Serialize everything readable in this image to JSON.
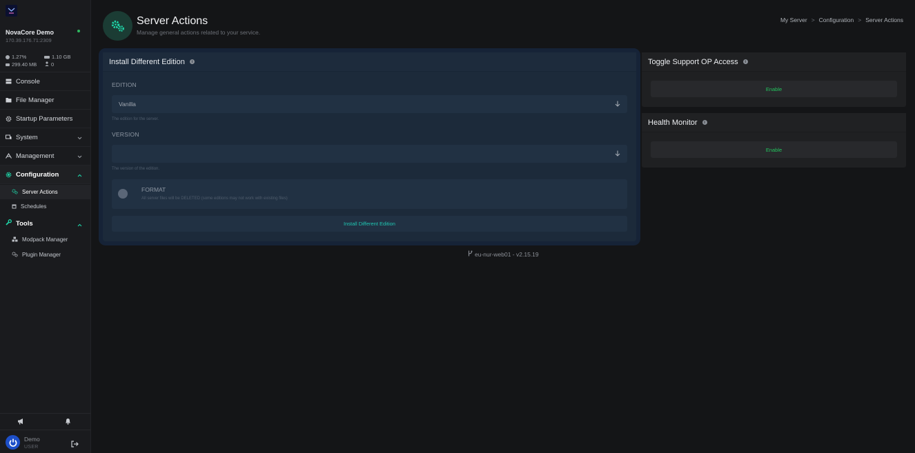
{
  "sidebar": {
    "server_name": "NovaCore Demo",
    "server_ip": "170.39.176.71:2309",
    "stats": {
      "cpu": "1.27%",
      "memory": "1.10 GB",
      "disk": "299.40 MB",
      "players": "0"
    },
    "nav": {
      "console": "Console",
      "file_manager": "File Manager",
      "startup_parameters": "Startup Parameters",
      "system": "System",
      "management": "Management",
      "configuration": "Configuration",
      "server_actions": "Server Actions",
      "schedules": "Schedules",
      "tools": "Tools",
      "modpack_manager": "Modpack Manager",
      "plugin_manager": "Plugin Manager"
    },
    "user": {
      "name": "Demo",
      "role": "USER"
    }
  },
  "header": {
    "title": "Server Actions",
    "subtitle": "Manage general actions related to your service.",
    "breadcrumb": [
      "My Server",
      "Configuration",
      "Server Actions"
    ],
    "breadcrumb_sep": ">"
  },
  "install_card": {
    "title": "Install Different Edition",
    "edition_label": "EDITION",
    "edition_value": "Vanilla",
    "edition_help": "The edition for the server.",
    "version_label": "VERSION",
    "version_value": "",
    "version_help": "The version of the edition.",
    "format_title": "FORMAT",
    "format_desc": "All server files will be DELETED (some editions may not work with existing files)",
    "format_enabled": false,
    "button": "Install Different Edition"
  },
  "footer": {
    "version": "eu-nur-web01 - v2.15.19"
  },
  "cards": {
    "support_op": {
      "title": "Toggle Support OP Access",
      "button": "Enable"
    },
    "health_monitor": {
      "title": "Health Monitor",
      "button": "Enable"
    }
  },
  "colors": {
    "accent": "#1fd6a9",
    "enable_green": "#23c45e",
    "online": "#2fb85f",
    "avatar": "#1d4fc8"
  },
  "icons": {
    "logo": "app-logo-icon",
    "cpu": "cpu-icon",
    "memory": "memory-icon",
    "disk": "disk-icon",
    "players": "user-icon",
    "page": "gears-icon",
    "branch": "git-branch-icon"
  }
}
